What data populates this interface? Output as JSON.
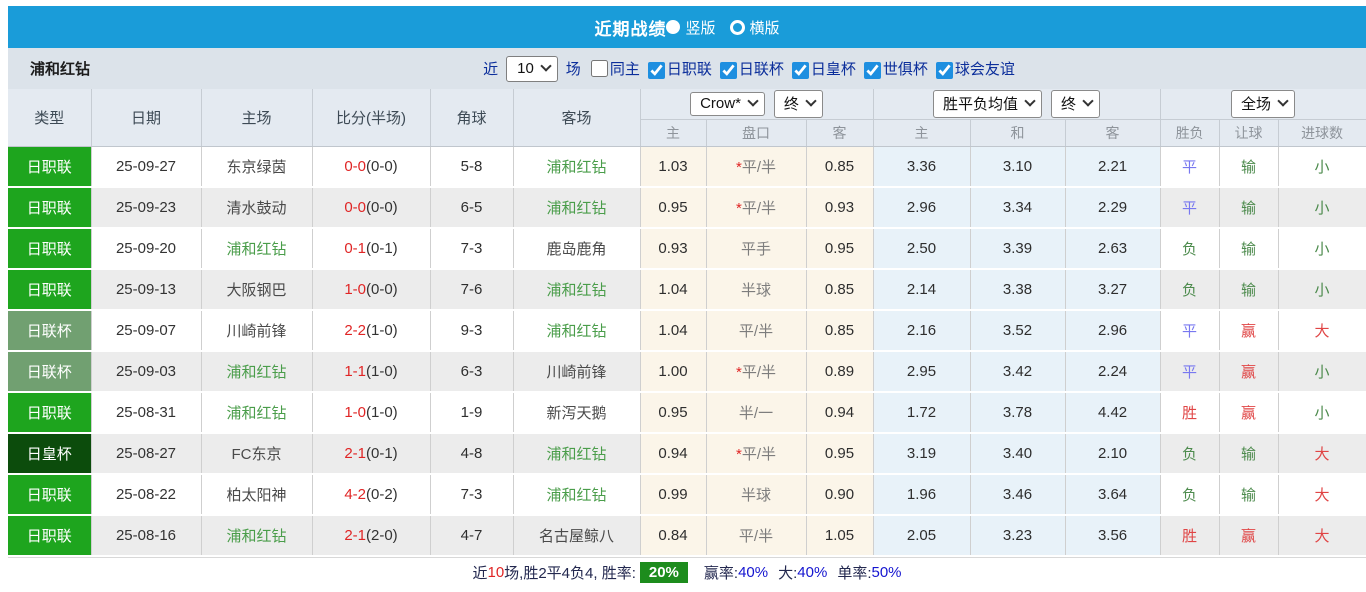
{
  "title_bar": {
    "title": "近期战绩",
    "radio_vertical": "竖版",
    "radio_horizontal": "横版"
  },
  "filter_bar": {
    "team": "浦和红钻",
    "near_label": "近",
    "count_value": "10",
    "games_label": "场",
    "same_home_label": "同主",
    "leagues": [
      {
        "label": "日职联",
        "checked": true
      },
      {
        "label": "日联杯",
        "checked": true
      },
      {
        "label": "日皇杯",
        "checked": true
      },
      {
        "label": "世俱杯",
        "checked": true
      },
      {
        "label": "球会友谊",
        "checked": true
      }
    ]
  },
  "table": {
    "headers": {
      "type": "类型",
      "date": "日期",
      "home": "主场",
      "score": "比分(半场)",
      "corner": "角球",
      "away": "客场",
      "odds_source": "Crow*",
      "odds_time": "终",
      "avg_source": "胜平负均值",
      "avg_time": "终",
      "full_match": "全场",
      "sub_odds_home": "主",
      "sub_odds_handicap": "盘口",
      "sub_odds_away": "客",
      "sub_avg_win": "主",
      "sub_avg_draw": "和",
      "sub_avg_lose": "客",
      "sub_result": "胜负",
      "sub_let_goal": "让球",
      "sub_goals": "进球数"
    },
    "rows": [
      {
        "league": "日职联",
        "league_style": "bright",
        "date": "25-09-27",
        "home": "东京绿茵",
        "home_hl": false,
        "score_ft": "0-0",
        "score_ht": "(0-0)",
        "corner": "5-8",
        "away": "浦和红钻",
        "away_hl": true,
        "odds_home": "1.03",
        "handicap": "平/半",
        "handicap_star": true,
        "odds_away": "0.85",
        "avg_win": "3.36",
        "avg_draw": "3.10",
        "avg_lose": "2.21",
        "result": "平",
        "let_goal": "输",
        "goals": "小"
      },
      {
        "league": "日职联",
        "league_style": "bright",
        "date": "25-09-23",
        "home": "清水鼓动",
        "home_hl": false,
        "score_ft": "0-0",
        "score_ht": "(0-0)",
        "corner": "6-5",
        "away": "浦和红钻",
        "away_hl": true,
        "odds_home": "0.95",
        "handicap": "平/半",
        "handicap_star": true,
        "odds_away": "0.93",
        "avg_win": "2.96",
        "avg_draw": "3.34",
        "avg_lose": "2.29",
        "result": "平",
        "let_goal": "输",
        "goals": "小"
      },
      {
        "league": "日职联",
        "league_style": "bright",
        "date": "25-09-20",
        "home": "浦和红钻",
        "home_hl": true,
        "score_ft": "0-1",
        "score_ht": "(0-1)",
        "corner": "7-3",
        "away": "鹿岛鹿角",
        "away_hl": false,
        "odds_home": "0.93",
        "handicap": "平手",
        "handicap_star": false,
        "odds_away": "0.95",
        "avg_win": "2.50",
        "avg_draw": "3.39",
        "avg_lose": "2.63",
        "result": "负",
        "let_goal": "输",
        "goals": "小"
      },
      {
        "league": "日职联",
        "league_style": "bright",
        "date": "25-09-13",
        "home": "大阪钢巴",
        "home_hl": false,
        "score_ft": "1-0",
        "score_ht": "(0-0)",
        "corner": "7-6",
        "away": "浦和红钻",
        "away_hl": true,
        "odds_home": "1.04",
        "handicap": "半球",
        "handicap_star": false,
        "odds_away": "0.85",
        "avg_win": "2.14",
        "avg_draw": "3.38",
        "avg_lose": "3.27",
        "result": "负",
        "let_goal": "输",
        "goals": "小"
      },
      {
        "league": "日联杯",
        "league_style": "muted",
        "date": "25-09-07",
        "home": "川崎前锋",
        "home_hl": false,
        "score_ft": "2-2",
        "score_ht": "(1-0)",
        "corner": "9-3",
        "away": "浦和红钻",
        "away_hl": true,
        "odds_home": "1.04",
        "handicap": "平/半",
        "handicap_star": false,
        "odds_away": "0.85",
        "avg_win": "2.16",
        "avg_draw": "3.52",
        "avg_lose": "2.96",
        "result": "平",
        "let_goal": "赢",
        "goals": "大"
      },
      {
        "league": "日联杯",
        "league_style": "muted",
        "date": "25-09-03",
        "home": "浦和红钻",
        "home_hl": true,
        "score_ft": "1-1",
        "score_ht": "(1-0)",
        "corner": "6-3",
        "away": "川崎前锋",
        "away_hl": false,
        "odds_home": "1.00",
        "handicap": "平/半",
        "handicap_star": true,
        "odds_away": "0.89",
        "avg_win": "2.95",
        "avg_draw": "3.42",
        "avg_lose": "2.24",
        "result": "平",
        "let_goal": "赢",
        "goals": "小"
      },
      {
        "league": "日职联",
        "league_style": "bright",
        "date": "25-08-31",
        "home": "浦和红钻",
        "home_hl": true,
        "score_ft": "1-0",
        "score_ht": "(1-0)",
        "corner": "1-9",
        "away": "新泻天鹅",
        "away_hl": false,
        "odds_home": "0.95",
        "handicap": "半/一",
        "handicap_star": false,
        "odds_away": "0.94",
        "avg_win": "1.72",
        "avg_draw": "3.78",
        "avg_lose": "4.42",
        "result": "胜",
        "let_goal": "赢",
        "goals": "小"
      },
      {
        "league": "日皇杯",
        "league_style": "dark",
        "date": "25-08-27",
        "home": "FC东京",
        "home_hl": false,
        "score_ft": "2-1",
        "score_ht": "(0-1)",
        "corner": "4-8",
        "away": "浦和红钻",
        "away_hl": true,
        "odds_home": "0.94",
        "handicap": "平/半",
        "handicap_star": true,
        "odds_away": "0.95",
        "avg_win": "3.19",
        "avg_draw": "3.40",
        "avg_lose": "2.10",
        "result": "负",
        "let_goal": "输",
        "goals": "大"
      },
      {
        "league": "日职联",
        "league_style": "bright",
        "date": "25-08-22",
        "home": "柏太阳神",
        "home_hl": false,
        "score_ft": "4-2",
        "score_ht": "(0-2)",
        "corner": "7-3",
        "away": "浦和红钻",
        "away_hl": true,
        "odds_home": "0.99",
        "handicap": "半球",
        "handicap_star": false,
        "odds_away": "0.90",
        "avg_win": "1.96",
        "avg_draw": "3.46",
        "avg_lose": "3.64",
        "result": "负",
        "let_goal": "输",
        "goals": "大"
      },
      {
        "league": "日职联",
        "league_style": "bright",
        "date": "25-08-16",
        "home": "浦和红钻",
        "home_hl": true,
        "score_ft": "2-1",
        "score_ht": "(2-0)",
        "corner": "4-7",
        "away": "名古屋鲸八",
        "away_hl": false,
        "odds_home": "0.84",
        "handicap": "平/半",
        "handicap_star": false,
        "odds_away": "1.05",
        "avg_win": "2.05",
        "avg_draw": "3.23",
        "avg_lose": "3.56",
        "result": "胜",
        "let_goal": "赢",
        "goals": "大"
      }
    ]
  },
  "footer": {
    "near": "近",
    "count": "10",
    "summary": "场,胜2平4负4, 胜率:",
    "rate": "20%",
    "win_label": "赢率:",
    "win_value": "40%",
    "big_label": "大:",
    "big_value": "40%",
    "single_label": "单率:",
    "single_value": "50%"
  },
  "colors": {
    "accent_blue": "#1a9cd9",
    "filter_bg": "#dce3ea",
    "header_bg": "#e4eaf1",
    "league_bright": "#1ea51e",
    "league_muted": "#71a071",
    "league_dark": "#0c4c0c",
    "team_highlight": "#4a9d4a",
    "score_red": "#e02525",
    "result_win": "#e04545",
    "result_draw": "#7878f0",
    "result_lose": "#4d8b4d",
    "odds_cream_bg": "#fbf5e9",
    "avg_blue_bg": "#e8f2f9",
    "rate_badge_green": "#1d8c1d",
    "footer_value_blue": "#1515d0"
  }
}
